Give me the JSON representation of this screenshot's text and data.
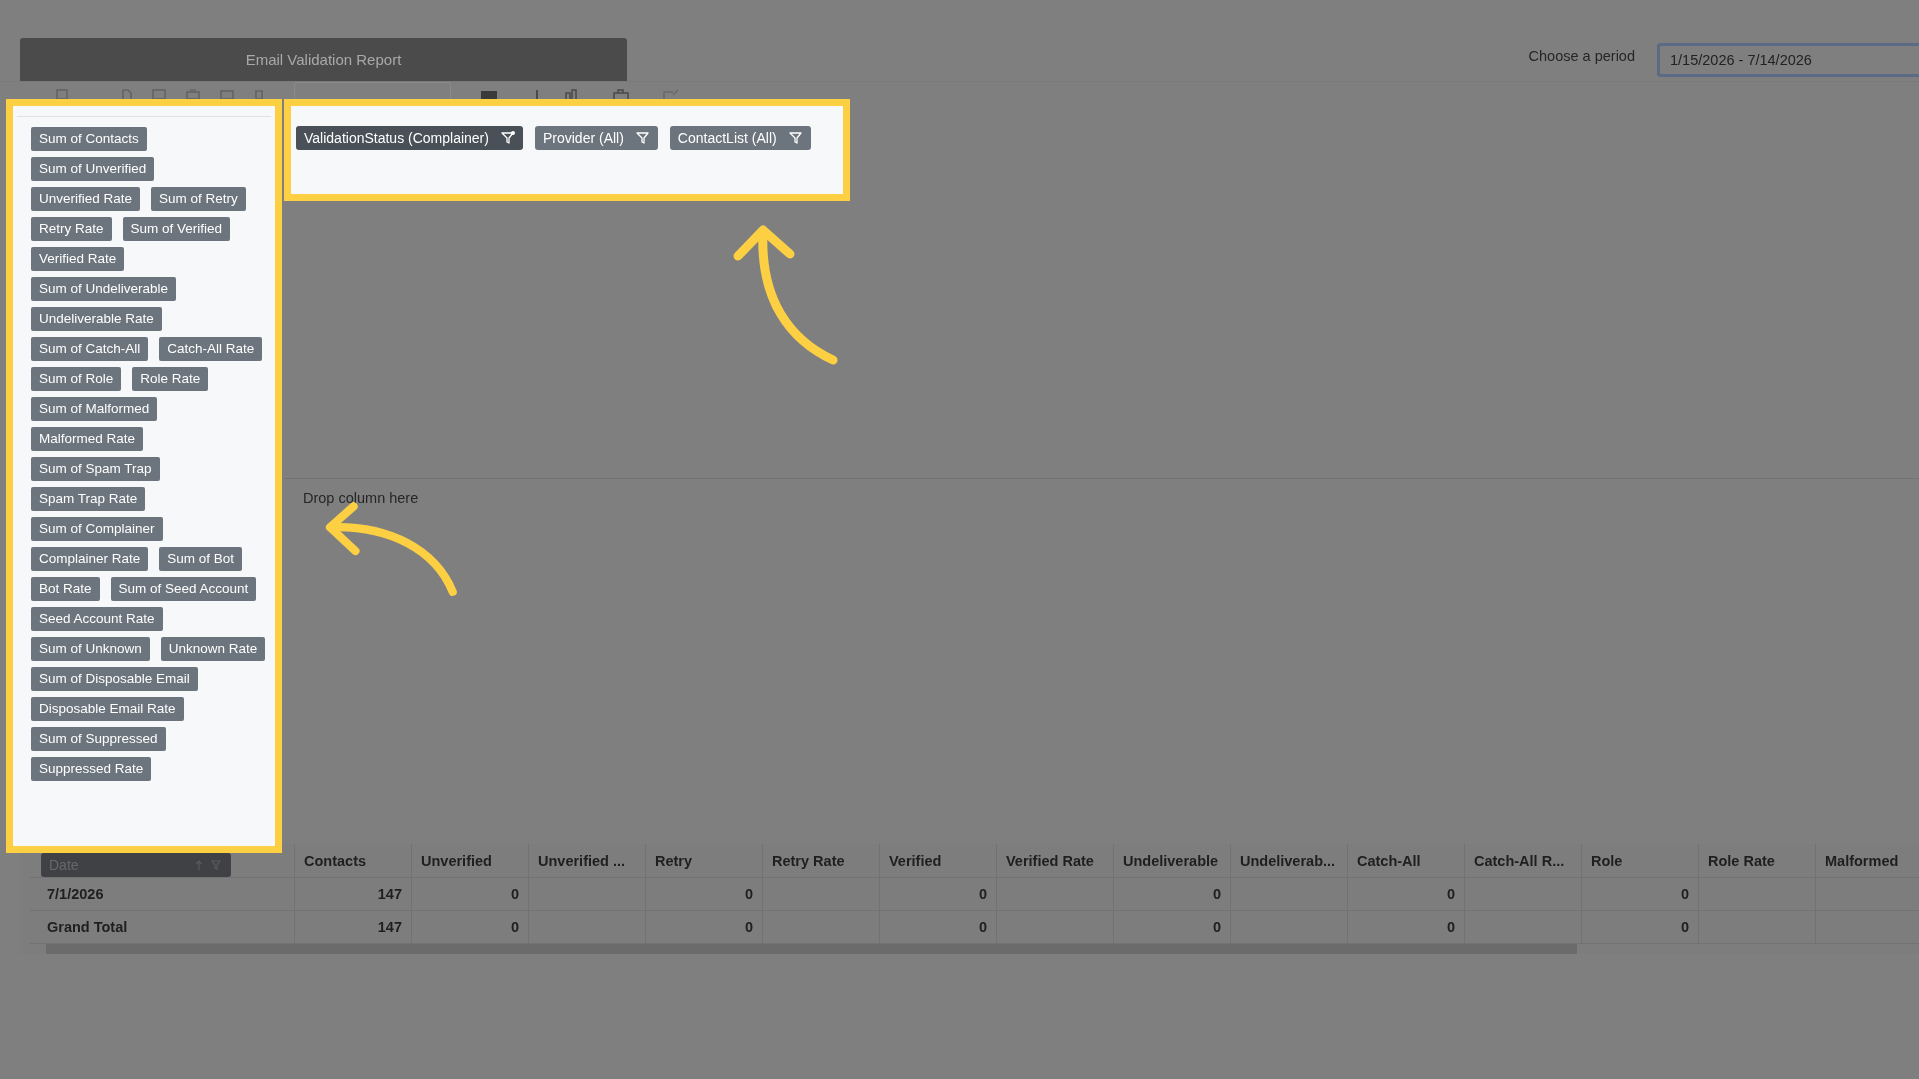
{
  "window": {
    "title": "Email Validation Report"
  },
  "period": {
    "label": "Choose a period",
    "value": "1/15/2026 - 7/14/2026"
  },
  "fields": [
    "Sum of Contacts",
    "Sum of Unverified",
    "Unverified Rate",
    "Sum of Retry",
    "Retry Rate",
    "Sum of Verified",
    "Verified Rate",
    "Sum of Undeliverable",
    "Undeliverable Rate",
    "Sum of Catch-All",
    "Catch-All Rate",
    "Sum of Role",
    "Role Rate",
    "Sum of Malformed",
    "Malformed Rate",
    "Sum of Spam Trap",
    "Spam Trap Rate",
    "Sum of Complainer",
    "Complainer Rate",
    "Sum of Bot",
    "Bot Rate",
    "Sum of Seed Account",
    "Seed Account Rate",
    "Sum of Unknown",
    "Unknown Rate",
    "Sum of Disposable Email",
    "Disposable Email Rate",
    "Sum of Suppressed",
    "Suppressed Rate"
  ],
  "filters": [
    {
      "label": "ValidationStatus (Complainer)",
      "active": true
    },
    {
      "label": "Provider (All)",
      "active": false
    },
    {
      "label": "ContactList (All)",
      "active": false
    }
  ],
  "drop_zone": "Drop column here",
  "table": {
    "row_header": "Date",
    "columns": [
      "Contacts",
      "Unverified",
      "Unverified ...",
      "Retry",
      "Retry Rate",
      "Verified",
      "Verified Rate",
      "Undeliverable",
      "Undeliverab...",
      "Catch-All",
      "Catch-All R...",
      "Role",
      "Role Rate",
      "Malformed"
    ],
    "rows": [
      {
        "label": "7/1/2026",
        "cells": [
          "147",
          "0",
          null,
          "0",
          null,
          "0",
          null,
          "0",
          null,
          "0",
          null,
          "0",
          null,
          null
        ]
      },
      {
        "label": "Grand Total",
        "cells": [
          "147",
          "0",
          null,
          "0",
          null,
          "0",
          null,
          "0",
          null,
          "0",
          null,
          "0",
          null,
          null
        ]
      }
    ]
  }
}
